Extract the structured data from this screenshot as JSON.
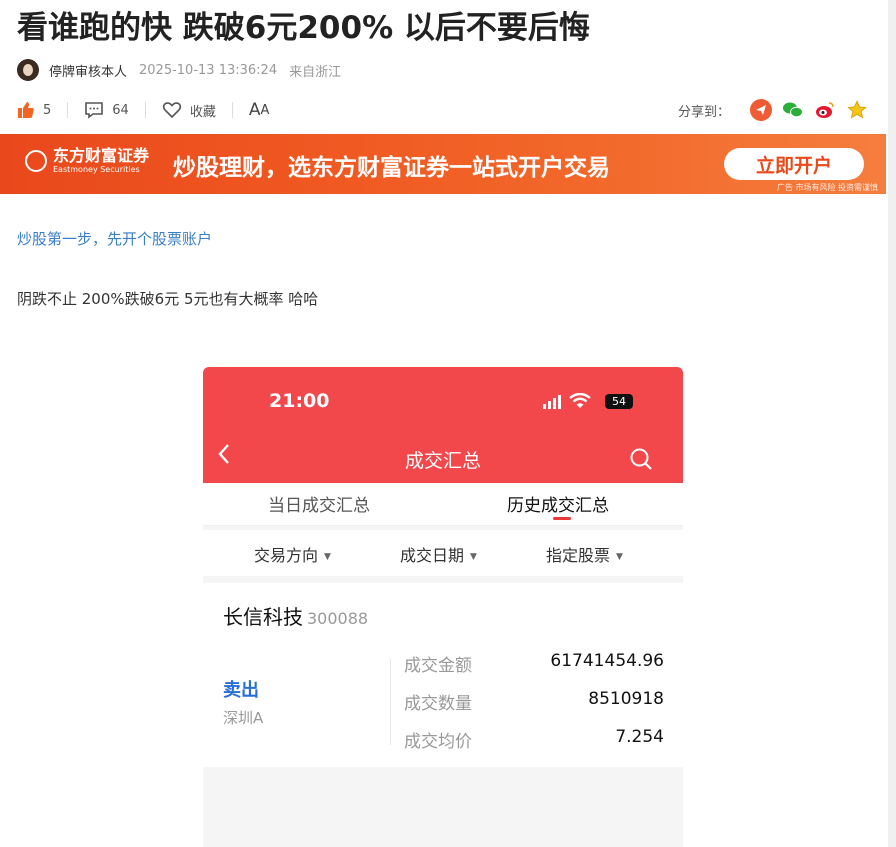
{
  "article": {
    "title": "看谁跑的快 跌破6元200% 以后不要后悔",
    "author": "停牌审核本人",
    "time": "2025-10-13 13:36:24",
    "source": "来自浙江"
  },
  "actions": {
    "like_count": "5",
    "comment_count": "64",
    "favorite_label": "收藏",
    "font_big": "A",
    "font_small": "A",
    "share_label": "分享到："
  },
  "banner": {
    "brand_cn": "东方财富证券",
    "brand_en": "Eastmoney Securities",
    "slogan": "炒股理财，选东方财富证券一站式开户交易",
    "cta": "立即开户",
    "ad_note": "广告 市场有风险 投资需谨慎"
  },
  "content": {
    "link_text": "炒股第一步，先开个股票账户",
    "paragraph": "阴跌不止 200%跌破6元 5元也有大概率 哈哈"
  },
  "phone": {
    "time": "21:00",
    "battery": "54",
    "title": "成交汇总",
    "tabs": [
      "当日成交汇总",
      "历史成交汇总"
    ],
    "filters": [
      "交易方向",
      "成交日期",
      "指定股票"
    ],
    "stock_name": "长信科技",
    "stock_code": "300088",
    "direction": "卖出",
    "market": "深圳A",
    "rows": [
      {
        "label": "成交金额",
        "value": "61741454.96"
      },
      {
        "label": "成交数量",
        "value": "8510918"
      },
      {
        "label": "成交均价",
        "value": "7.254"
      }
    ]
  },
  "colors": {
    "phone_header": "#f2474b",
    "banner": "#f05a22",
    "link": "#3a7fc6",
    "sell": "#2a6fd8"
  }
}
